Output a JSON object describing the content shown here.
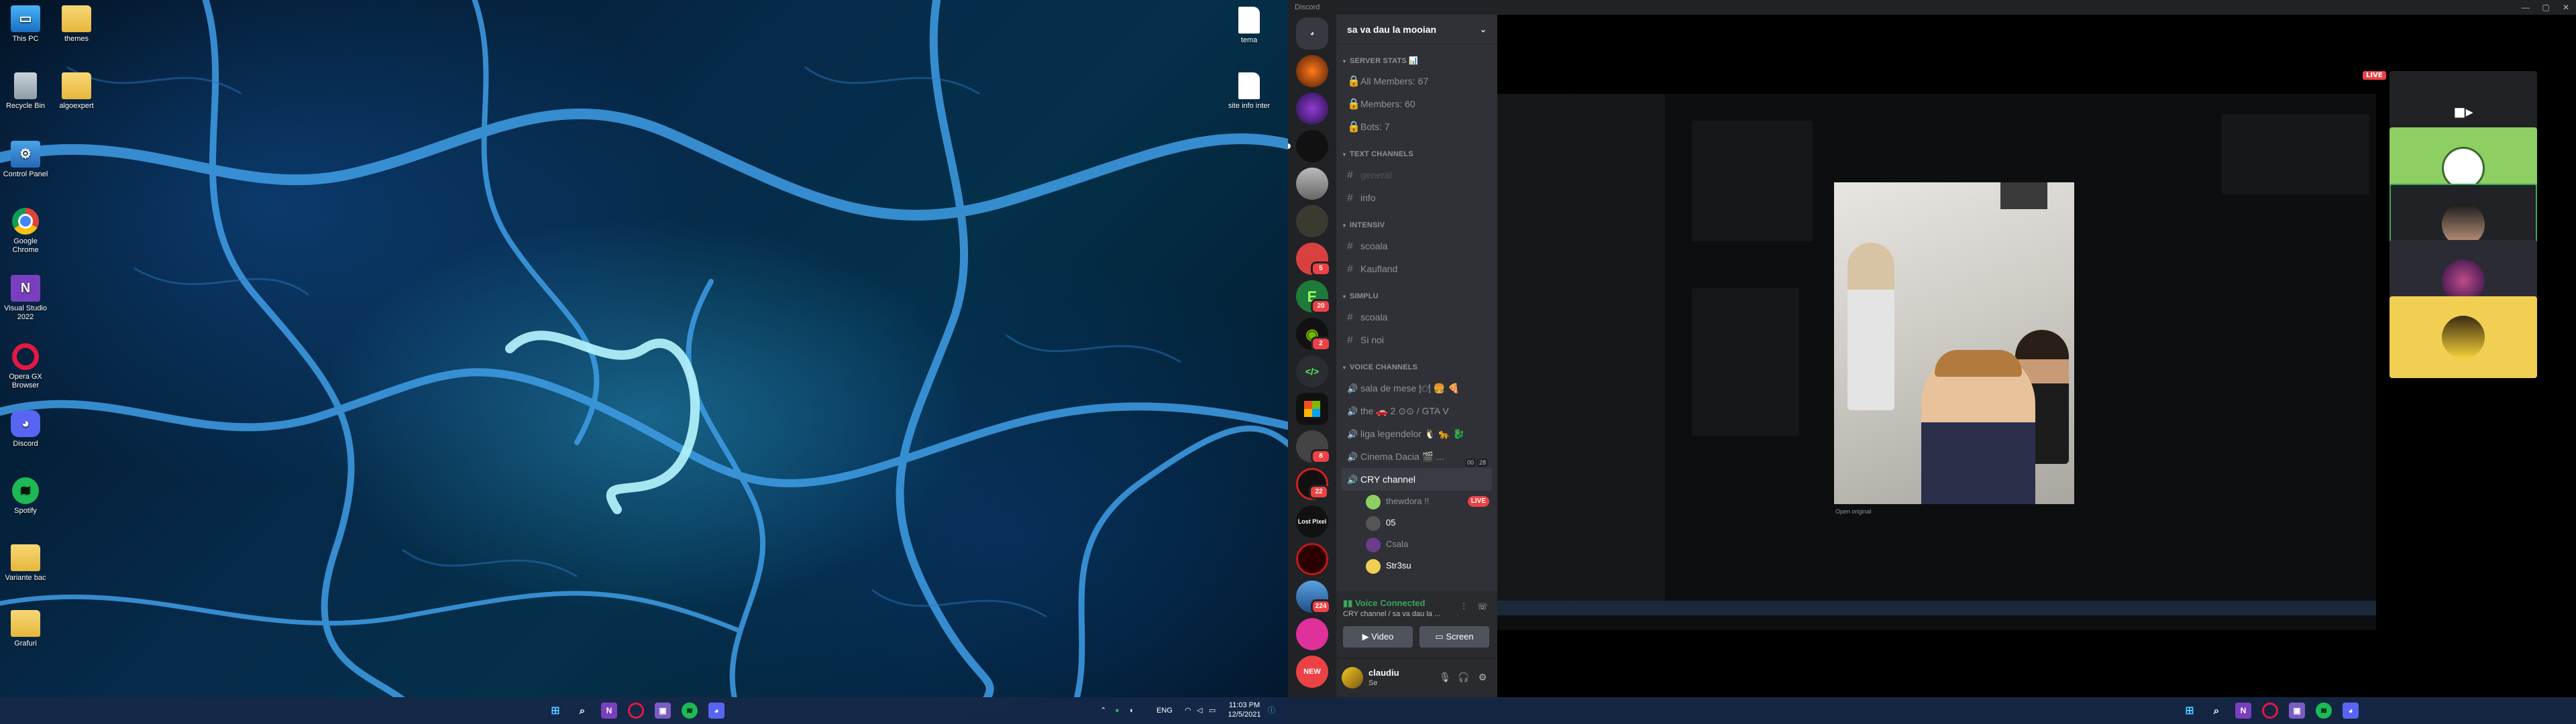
{
  "left_desktop": {
    "icons": [
      {
        "label": "This PC",
        "icon": "monitor-icon"
      },
      {
        "label": "themes",
        "icon": "folder-icon"
      },
      {
        "label": "Recycle Bin",
        "icon": "recycle-bin-icon"
      },
      {
        "label": "algoexpert",
        "icon": "folder-icon"
      },
      {
        "label": "Control Panel",
        "icon": "control-panel-icon"
      },
      {
        "label": "Google Chrome",
        "icon": "chrome-icon"
      },
      {
        "label": "Visual Studio 2022",
        "icon": "visual-studio-icon"
      },
      {
        "label": "Opera GX Browser",
        "icon": "opera-icon"
      },
      {
        "label": "Discord",
        "icon": "discord-icon"
      },
      {
        "label": "Spotify",
        "icon": "spotify-icon"
      },
      {
        "label": "Variante bac",
        "icon": "folder-icon"
      },
      {
        "label": "Grafuri",
        "icon": "folder-icon"
      },
      {
        "label": "tema",
        "icon": "file-icon"
      },
      {
        "label": "site info inter",
        "icon": "file-icon"
      }
    ]
  },
  "left_taskbar": {
    "tray": {
      "language": "ENG",
      "time": "11:03 PM",
      "date": "12/5/2021"
    }
  },
  "discord": {
    "window_title": "Discord",
    "server_name": "sa va dau la mooian",
    "guild_badges": [
      "5",
      "20",
      "2",
      "8",
      "22",
      "224",
      "NEW"
    ],
    "guild_labels": {
      "lost_pixel": "Lost Pixel"
    },
    "categories": {
      "server_stats": "SERVER STATS 📊",
      "text": "TEXT CHANNELS",
      "intensiv": "INTENSIV",
      "simplu": "SIMPLU",
      "voice": "VOICE CHANNELS"
    },
    "stats_channels": [
      "All Members: 67",
      "Members: 60",
      "Bots: 7"
    ],
    "text_channels": [
      "general",
      "info"
    ],
    "intensiv_channels": [
      "scoala",
      "Kaufland"
    ],
    "simplu_channels": [
      "scoala",
      "Si noi"
    ],
    "voice_channels": [
      "sala de mese 🍽 🍔 🍕",
      "the 🚗 2 ⊙⊙ / GTA V",
      "liga legendelor 🐧 🐆 🐉",
      "Cinema Dacia 🎬 ...",
      "CRY channel"
    ],
    "cinema_badges": [
      "00",
      "28"
    ],
    "voice_users": [
      {
        "name": "thewdora !!",
        "live": "LIVE"
      },
      {
        "name": "05"
      },
      {
        "name": "Csala"
      },
      {
        "name": "Str3su"
      }
    ],
    "voice_panel": {
      "status": "Voice Connected",
      "sub": "CRY channel / sa va dau la ...",
      "video_label": "Video",
      "screen_label": "Screen"
    },
    "user": {
      "name": "claudiu",
      "tag": "Se"
    },
    "stream": {
      "caption": "Open original",
      "live": "LIVE"
    }
  },
  "colors": {
    "discord_bg": "#36393f",
    "channel_panel": "#2f3136",
    "guild_bar": "#202225",
    "live_red": "#ed4245",
    "voice_green": "#3ba55d",
    "taskbar": "#162848"
  }
}
